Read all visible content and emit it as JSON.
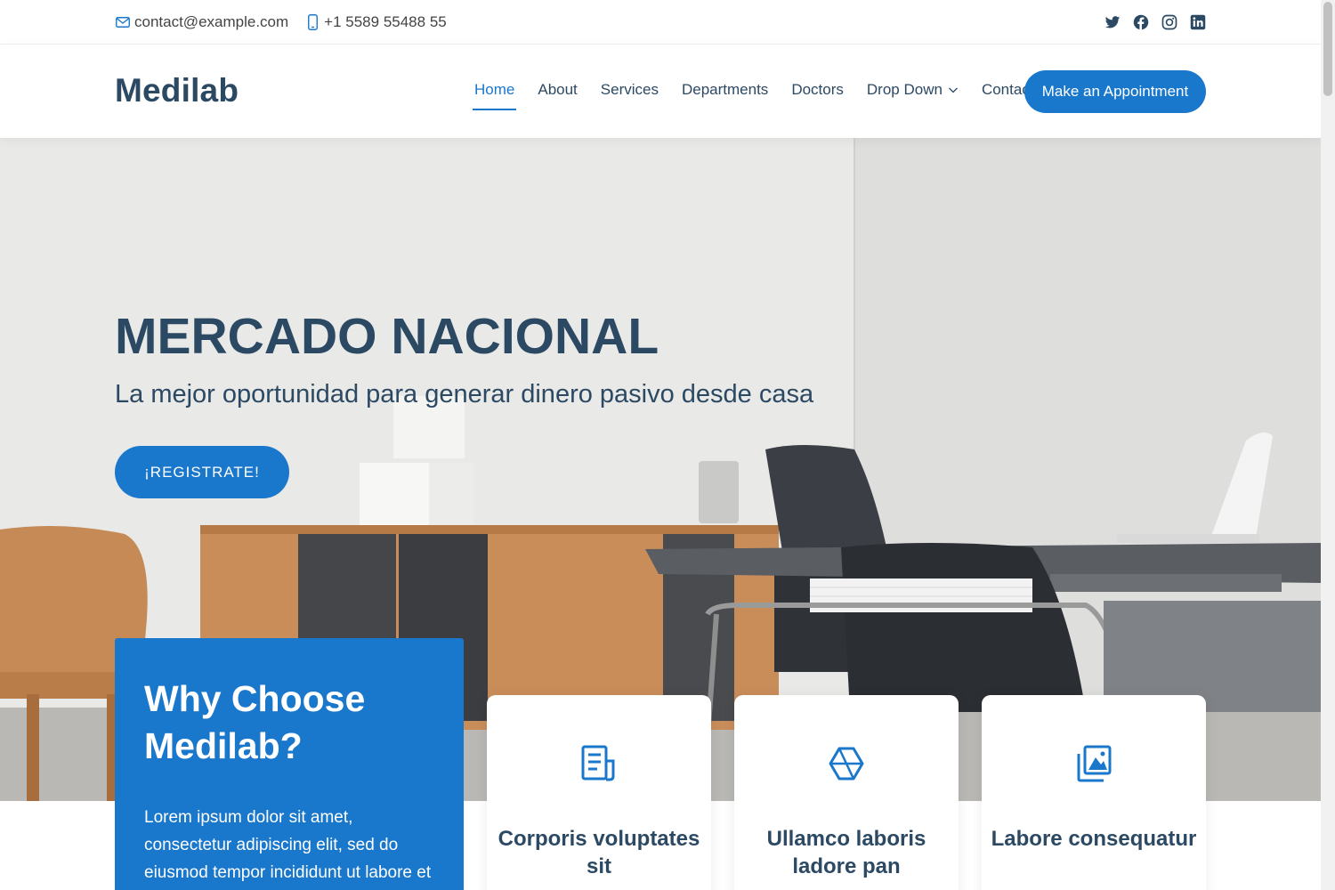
{
  "topbar": {
    "email": "contact@example.com",
    "phone": "+1 5589 55488 55",
    "email_icon": "envelope-icon",
    "phone_icon": "phone-icon",
    "social": [
      "twitter-icon",
      "facebook-icon",
      "instagram-icon",
      "linkedin-icon"
    ]
  },
  "header": {
    "logo": "Medilab",
    "nav": [
      "Home",
      "About",
      "Services",
      "Departments",
      "Doctors",
      "Drop Down",
      "Contact"
    ],
    "active_nav": "Home",
    "appointment_label": "Make an Appointment"
  },
  "hero": {
    "title": "MERCADO NACIONAL",
    "subtitle": "La mejor oportunidad para generar dinero pasivo desde casa",
    "button_label": "¡REGISTRATE!"
  },
  "why": {
    "title": "Why Choose Medilab?",
    "text": "Lorem ipsum dolor sit amet, consectetur adipiscing elit, sed do eiusmod tempor incididunt ut labore et dolore magna"
  },
  "icon_boxes": [
    {
      "icon": "document-icon",
      "title": "Corporis voluptates sit"
    },
    {
      "icon": "hexagon-icon",
      "title": "Ullamco laboris ladore pan"
    },
    {
      "icon": "images-icon",
      "title": "Labore consequatur"
    }
  ],
  "colors": {
    "accent": "#1977cc",
    "heading": "#2c4964"
  }
}
